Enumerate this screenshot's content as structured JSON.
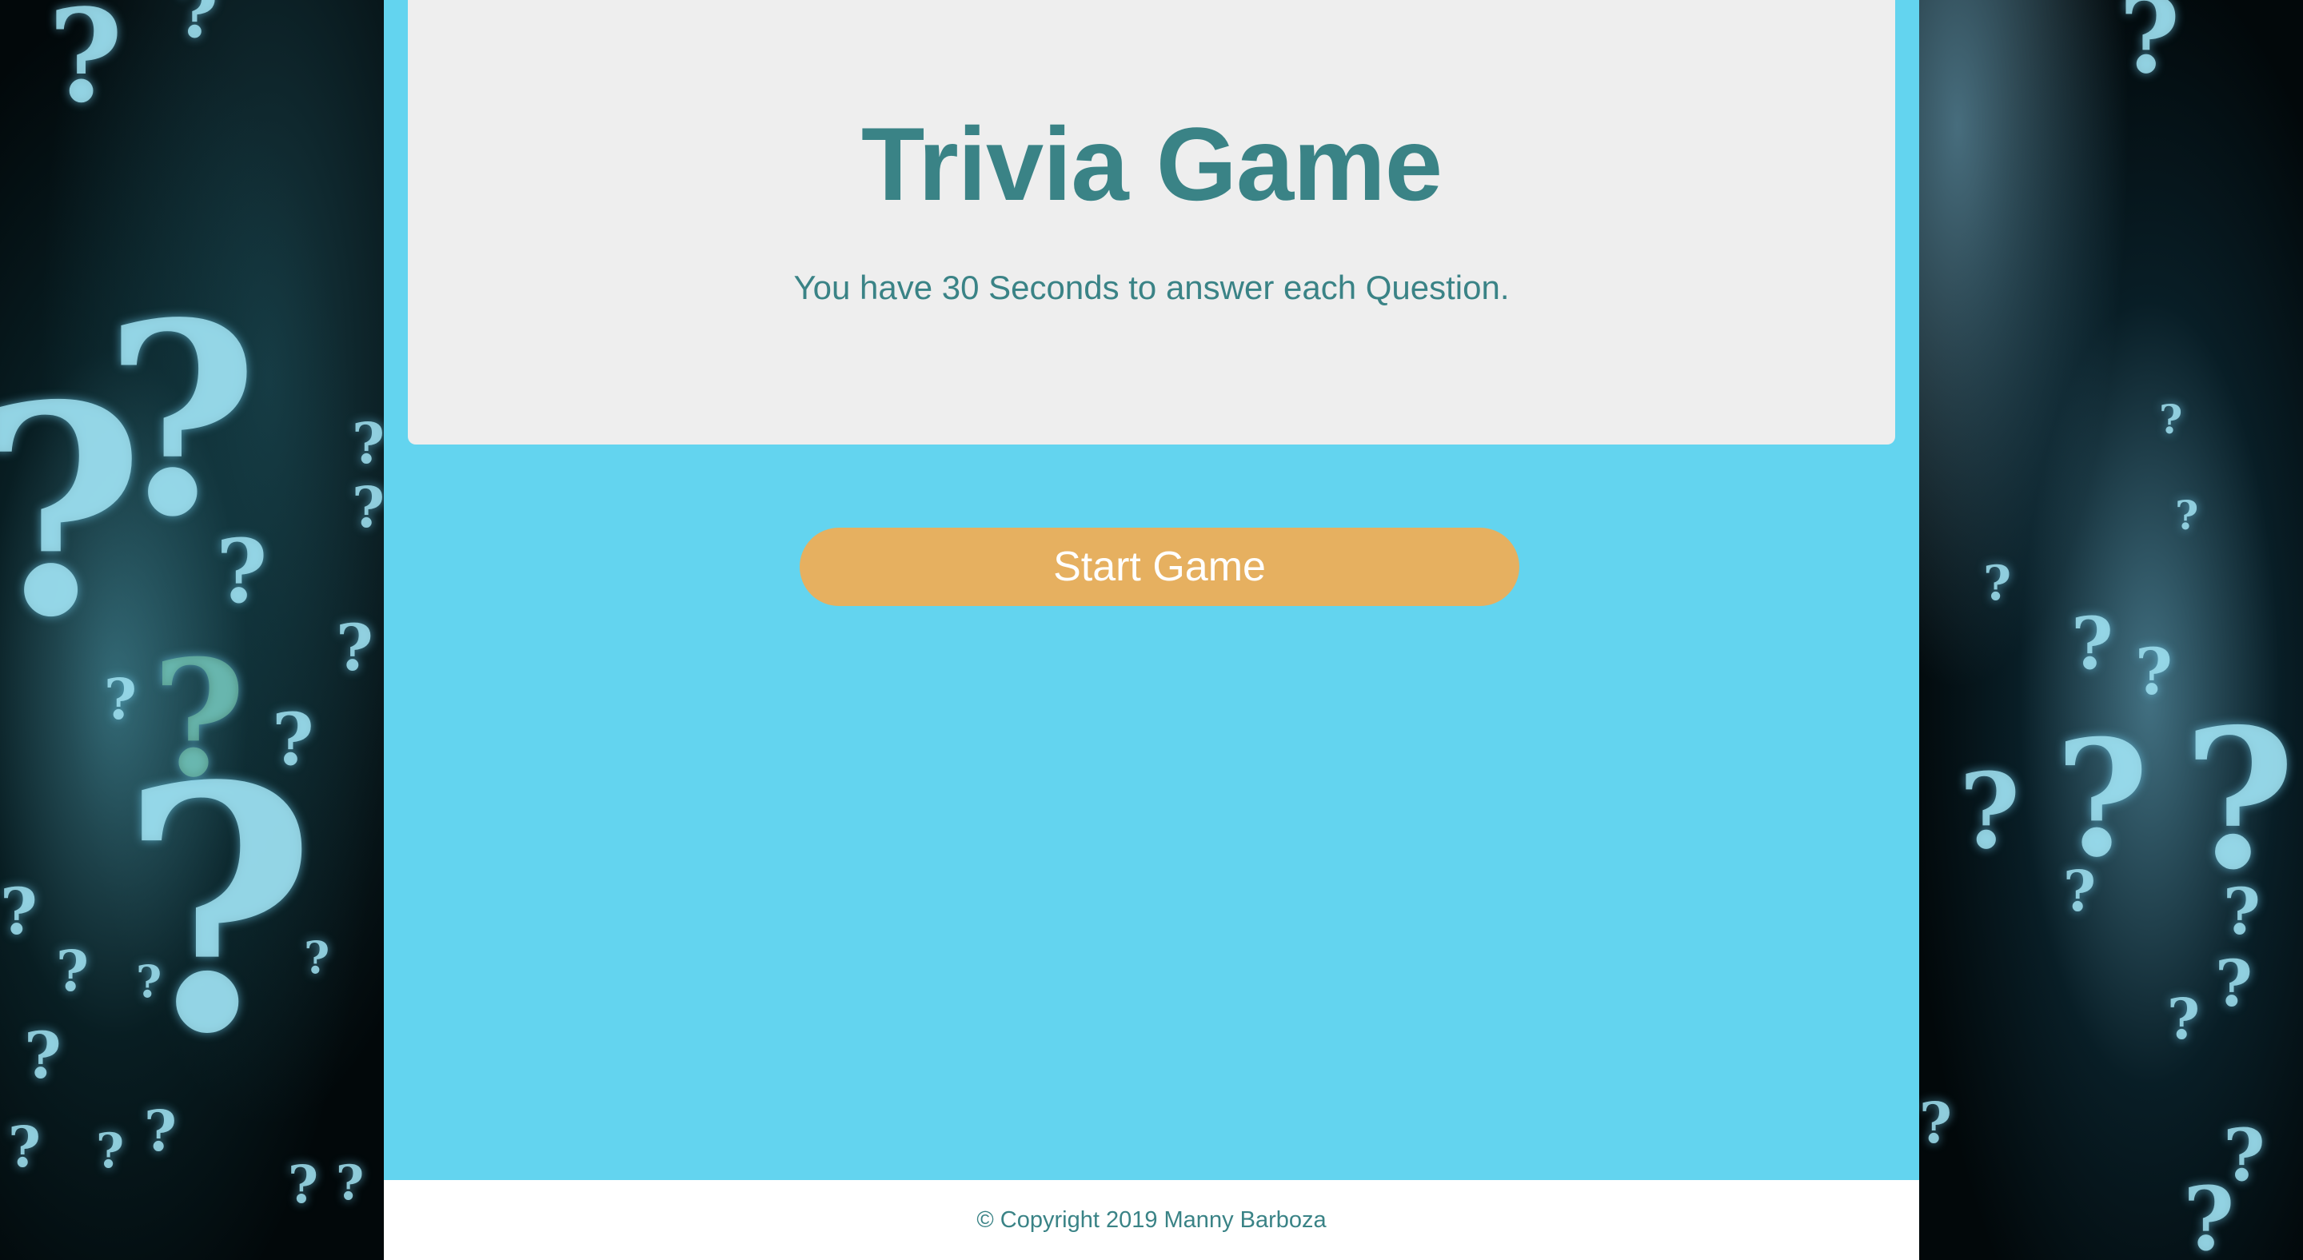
{
  "header": {
    "title": "Trivia Game",
    "subtitle": "You have 30 Seconds to answer each Question."
  },
  "actions": {
    "start_label": "Start Game"
  },
  "footer": {
    "copyright": "© Copyright 2019 Manny Barboza"
  },
  "colors": {
    "main_background": "#63d4ef",
    "card_background": "#eeeeee",
    "title_text": "#3a8386",
    "button_background": "#e6b060",
    "button_text": "#ffffff",
    "footer_background": "#ffffff"
  },
  "background_image": {
    "motif": "question-marks"
  }
}
